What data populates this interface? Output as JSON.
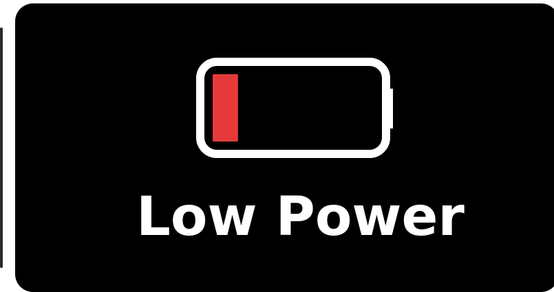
{
  "status": {
    "label": "Low Power",
    "battery_level_percent": 15
  },
  "colors": {
    "card_background": "#000000",
    "battery_outline": "#ffffff",
    "battery_fill": "#e63a3a",
    "text": "#ffffff"
  },
  "icons": {
    "battery": "battery-low-icon"
  }
}
